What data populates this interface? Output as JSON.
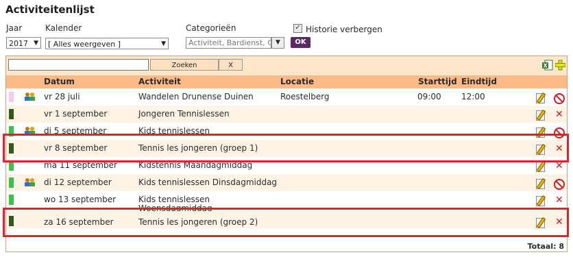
{
  "page": {
    "title": "Activiteitenlijst"
  },
  "filters": {
    "jaar_label": "Jaar",
    "jaar_value": "2017",
    "kalender_label": "Kalender",
    "kalender_value": "[ Alles weergeven ]",
    "categorieen_label": "Categorieën",
    "categorieen_value": "Activiteit, Bardienst, C",
    "historie_label": "Historie verbergen",
    "historie_checked": true,
    "ok_label": "OK"
  },
  "toolbar": {
    "search_placeholder": "",
    "search_button": "Zoeken",
    "clear_button": "X"
  },
  "table": {
    "headers": {
      "datum": "Datum",
      "activiteit": "Activiteit",
      "locatie": "Locatie",
      "starttijd": "Starttijd",
      "eindtijd": "Eindtijd"
    },
    "rows": [
      {
        "datum": "vr 28 juli",
        "activiteit": "Wandelen Drunense Duinen",
        "locatie": "Roestelberg",
        "starttijd": "09:00",
        "eindtijd": "12:00",
        "stripe": "#f9c8ee",
        "group": true,
        "action": "block"
      },
      {
        "datum": "vr 1 september",
        "activiteit": "Jongeren Tennislessen",
        "locatie": "",
        "starttijd": "",
        "eindtijd": "",
        "stripe": "#2f5a1a",
        "group": false,
        "action": "delete"
      },
      {
        "datum": "di 5 september",
        "activiteit": "Kids tennislessen",
        "locatie": "",
        "starttijd": "",
        "eindtijd": "",
        "stripe": "#39c34a",
        "group": true,
        "action": "block"
      },
      {
        "datum": "vr 8 september",
        "activiteit": "Tennis les jongeren (groep 1)",
        "locatie": "",
        "starttijd": "",
        "eindtijd": "",
        "stripe": "#2f5a1a",
        "group": false,
        "action": "delete"
      },
      {
        "datum": "ma 11 september",
        "activiteit": "Kidstennis Maandagmiddag",
        "locatie": "",
        "starttijd": "",
        "eindtijd": "",
        "stripe": "#39c34a",
        "group": false,
        "action": "delete"
      },
      {
        "datum": "di 12 september",
        "activiteit": "Kids tennislessen Dinsdagmiddag",
        "locatie": "",
        "starttijd": "",
        "eindtijd": "",
        "stripe": "#39c34a",
        "group": true,
        "action": "block"
      },
      {
        "datum": "wo 13 september",
        "activiteit": "Kids tennislessen",
        "activiteit2": "Woensdagmiddag",
        "locatie": "",
        "starttijd": "",
        "eindtijd": "",
        "stripe": "#39c34a",
        "group": false,
        "action": "delete"
      },
      {
        "datum": "za 16 september",
        "activiteit": "Tennis les jongeren (groep 2)",
        "locatie": "",
        "starttijd": "",
        "eindtijd": "",
        "stripe": "#2f5a1a",
        "group": false,
        "action": "delete"
      }
    ],
    "total_label": "Totaal: 8"
  },
  "colors": {
    "accent": "#5b2a63",
    "header_bg": "#fdba86",
    "toolbar_bg": "#ffe7cc",
    "highlight": "#e3202b"
  }
}
